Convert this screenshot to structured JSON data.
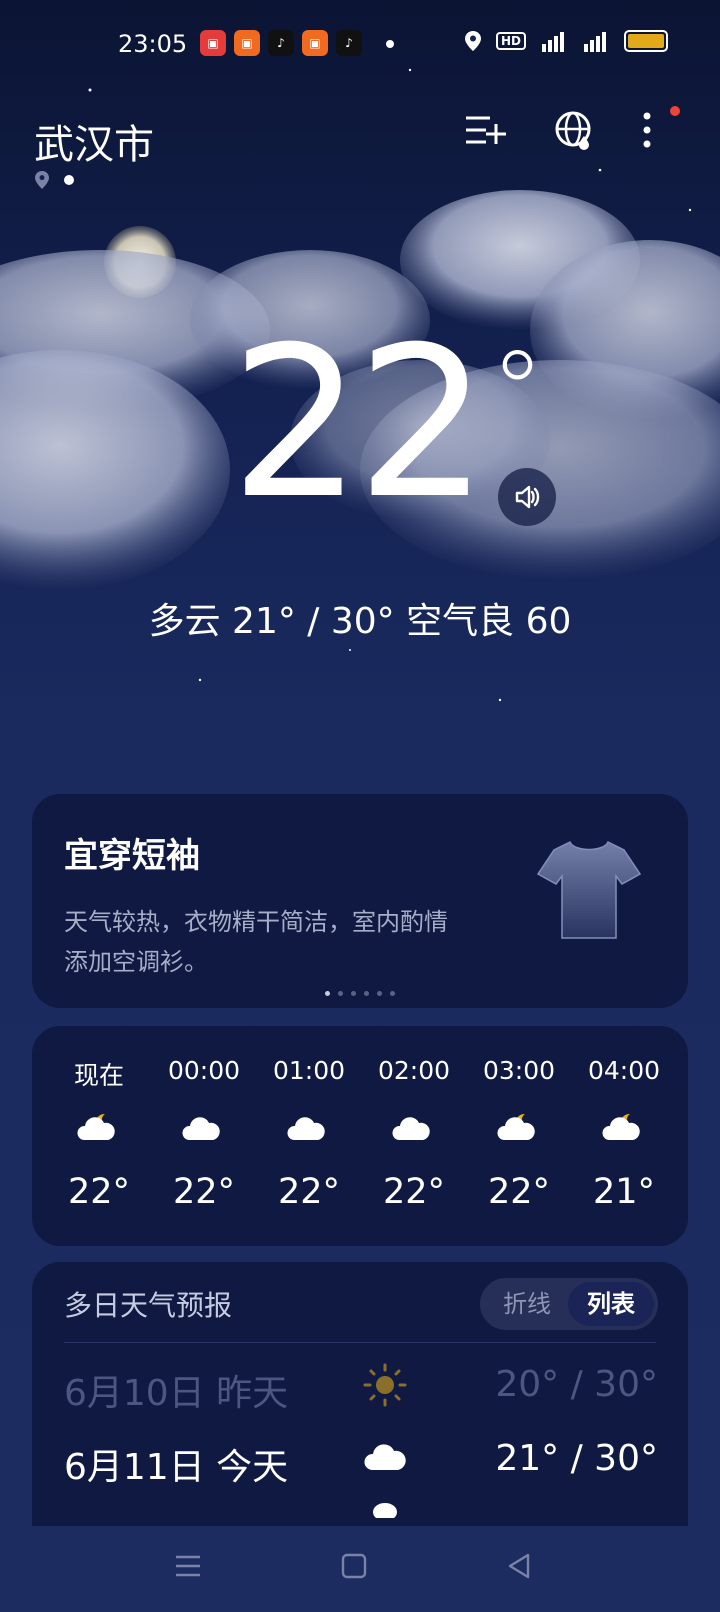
{
  "status_bar": {
    "time": "23:05",
    "right_icons": [
      "location-icon",
      "hd-icon",
      "signal-icon",
      "signal-icon",
      "battery-icon"
    ]
  },
  "header": {
    "city": "武汉市"
  },
  "current": {
    "temperature": "22",
    "degree": "°",
    "summary": "多云  21° / 30°  空气良 60"
  },
  "dress_card": {
    "title": "宜穿短袖",
    "description": "天气较热，衣物精干简洁，室内酌情添加空调衫。"
  },
  "hourly": [
    {
      "time": "现在",
      "temp": "22°",
      "icon": "cloudy-night-icon"
    },
    {
      "time": "00:00",
      "temp": "22°",
      "icon": "cloud-icon"
    },
    {
      "time": "01:00",
      "temp": "22°",
      "icon": "cloud-icon"
    },
    {
      "time": "02:00",
      "temp": "22°",
      "icon": "cloud-icon"
    },
    {
      "time": "03:00",
      "temp": "22°",
      "icon": "cloudy-night-icon"
    },
    {
      "time": "04:00",
      "temp": "21°",
      "icon": "cloudy-night-icon"
    }
  ],
  "daily": {
    "title": "多日天气预报",
    "toggle": {
      "option_a": "折线",
      "option_b": "列表",
      "selected": "列表"
    },
    "rows": [
      {
        "date": "6月10日  昨天",
        "range": "20° / 30°",
        "icon": "sun-icon"
      },
      {
        "date": "6月11日  今天",
        "range": "21° / 30°",
        "icon": "cloud-icon"
      }
    ]
  },
  "colors": {
    "accent_moon": "#e2a91b",
    "notification_dot": "#f04437",
    "card_bg": "#0e163c"
  }
}
